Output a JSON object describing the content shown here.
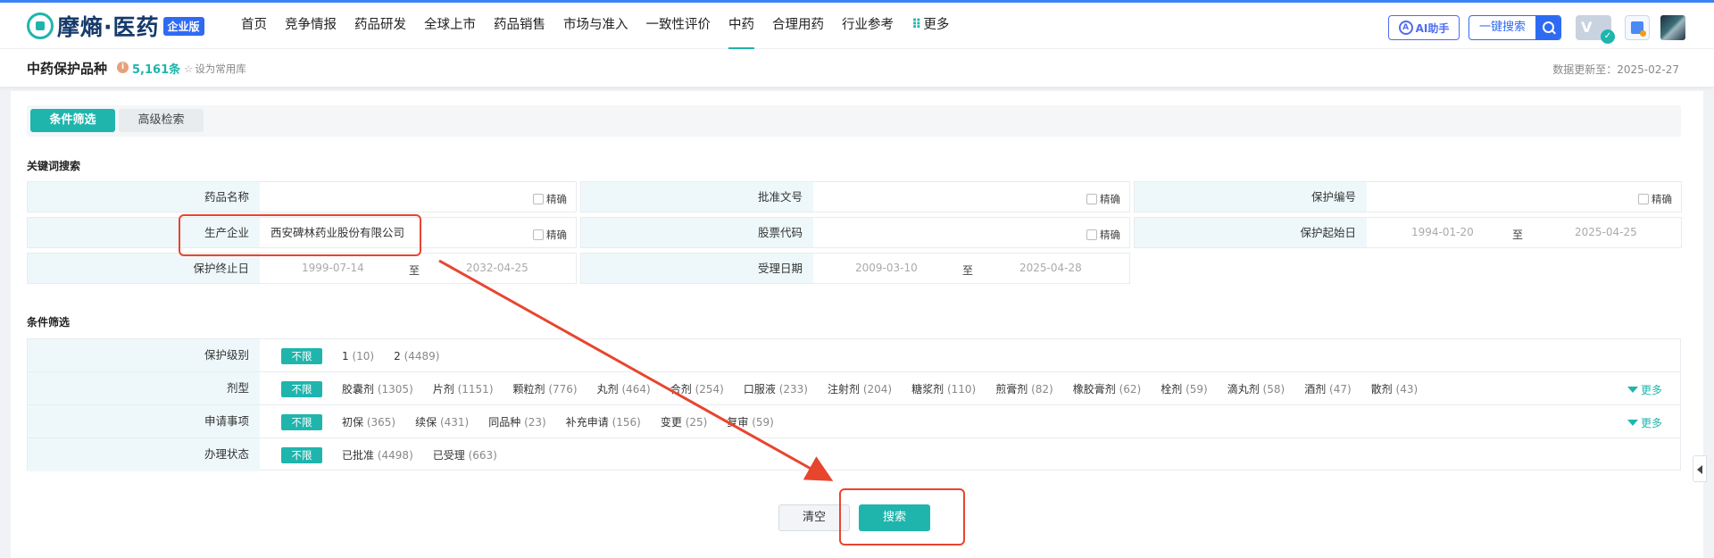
{
  "brand": {
    "name": "摩熵·医药",
    "edition_badge": "企业版"
  },
  "nav": {
    "items": [
      "首页",
      "竞争情报",
      "药品研发",
      "全球上市",
      "药品销售",
      "市场与准入",
      "一致性评价",
      "中药",
      "合理用药",
      "行业参考"
    ],
    "more_label": "更多",
    "active": "中药",
    "ai_label": "AI助手",
    "search_label": "一键搜索"
  },
  "subheader": {
    "title": "中药保护品种",
    "count": "5,161条",
    "fav_label": "设为常用库",
    "update_label": "数据更新至：2025-02-27"
  },
  "tabs": [
    "条件筛选",
    "高级检索"
  ],
  "keyword_section": {
    "title": "关键词搜索",
    "exact_label": "精确",
    "date_sep": "至",
    "fields": {
      "drug_name": {
        "label": "药品名称",
        "value": ""
      },
      "approval_no": {
        "label": "批准文号",
        "value": ""
      },
      "protect_no": {
        "label": "保护编号",
        "value": ""
      },
      "manufacturer": {
        "label": "生产企业",
        "value": "西安碑林药业股份有限公司"
      },
      "stock_code": {
        "label": "股票代码",
        "value": ""
      },
      "protect_start": {
        "label": "保护起始日",
        "from": "1994-01-20",
        "to": "2025-04-25"
      },
      "protect_end": {
        "label": "保护终止日",
        "from": "1999-07-14",
        "to": "2032-04-25"
      },
      "accept_date": {
        "label": "受理日期",
        "from": "2009-03-10",
        "to": "2025-04-28"
      }
    }
  },
  "filter_section": {
    "title": "条件筛选",
    "all_label": "不限",
    "more_label": "更多",
    "rows": [
      {
        "label": "保护级别",
        "options": [
          {
            "name": "1",
            "count": "(10)"
          },
          {
            "name": "2",
            "count": "(4489)"
          }
        ]
      },
      {
        "label": "剂型",
        "options": [
          {
            "name": "胶囊剂",
            "count": "(1305)"
          },
          {
            "name": "片剂",
            "count": "(1151)"
          },
          {
            "name": "颗粒剂",
            "count": "(776)"
          },
          {
            "name": "丸剂",
            "count": "(464)"
          },
          {
            "name": "合剂",
            "count": "(254)"
          },
          {
            "name": "口服液",
            "count": "(233)"
          },
          {
            "name": "注射剂",
            "count": "(204)"
          },
          {
            "name": "糖浆剂",
            "count": "(110)"
          },
          {
            "name": "煎膏剂",
            "count": "(82)"
          },
          {
            "name": "橡胶膏剂",
            "count": "(62)"
          },
          {
            "name": "栓剂",
            "count": "(59)"
          },
          {
            "name": "滴丸剂",
            "count": "(58)"
          },
          {
            "name": "酒剂",
            "count": "(47)"
          },
          {
            "name": "散剂",
            "count": "(43)"
          }
        ]
      },
      {
        "label": "申请事项",
        "options": [
          {
            "name": "初保",
            "count": "(365)"
          },
          {
            "name": "续保",
            "count": "(431)"
          },
          {
            "name": "同品种",
            "count": "(23)"
          },
          {
            "name": "补充申请",
            "count": "(156)"
          },
          {
            "name": "变更",
            "count": "(25)"
          },
          {
            "name": "复审",
            "count": "(59)"
          }
        ]
      },
      {
        "label": "办理状态",
        "options": [
          {
            "name": "已批准",
            "count": "(4498)"
          },
          {
            "name": "已受理",
            "count": "(663)"
          }
        ]
      }
    ]
  },
  "actions": {
    "clear_label": "清空",
    "search_label": "搜索"
  },
  "colors": {
    "accent": "#1fb5ad",
    "primary": "#2f6bf2",
    "annotation": "#e8452e"
  }
}
